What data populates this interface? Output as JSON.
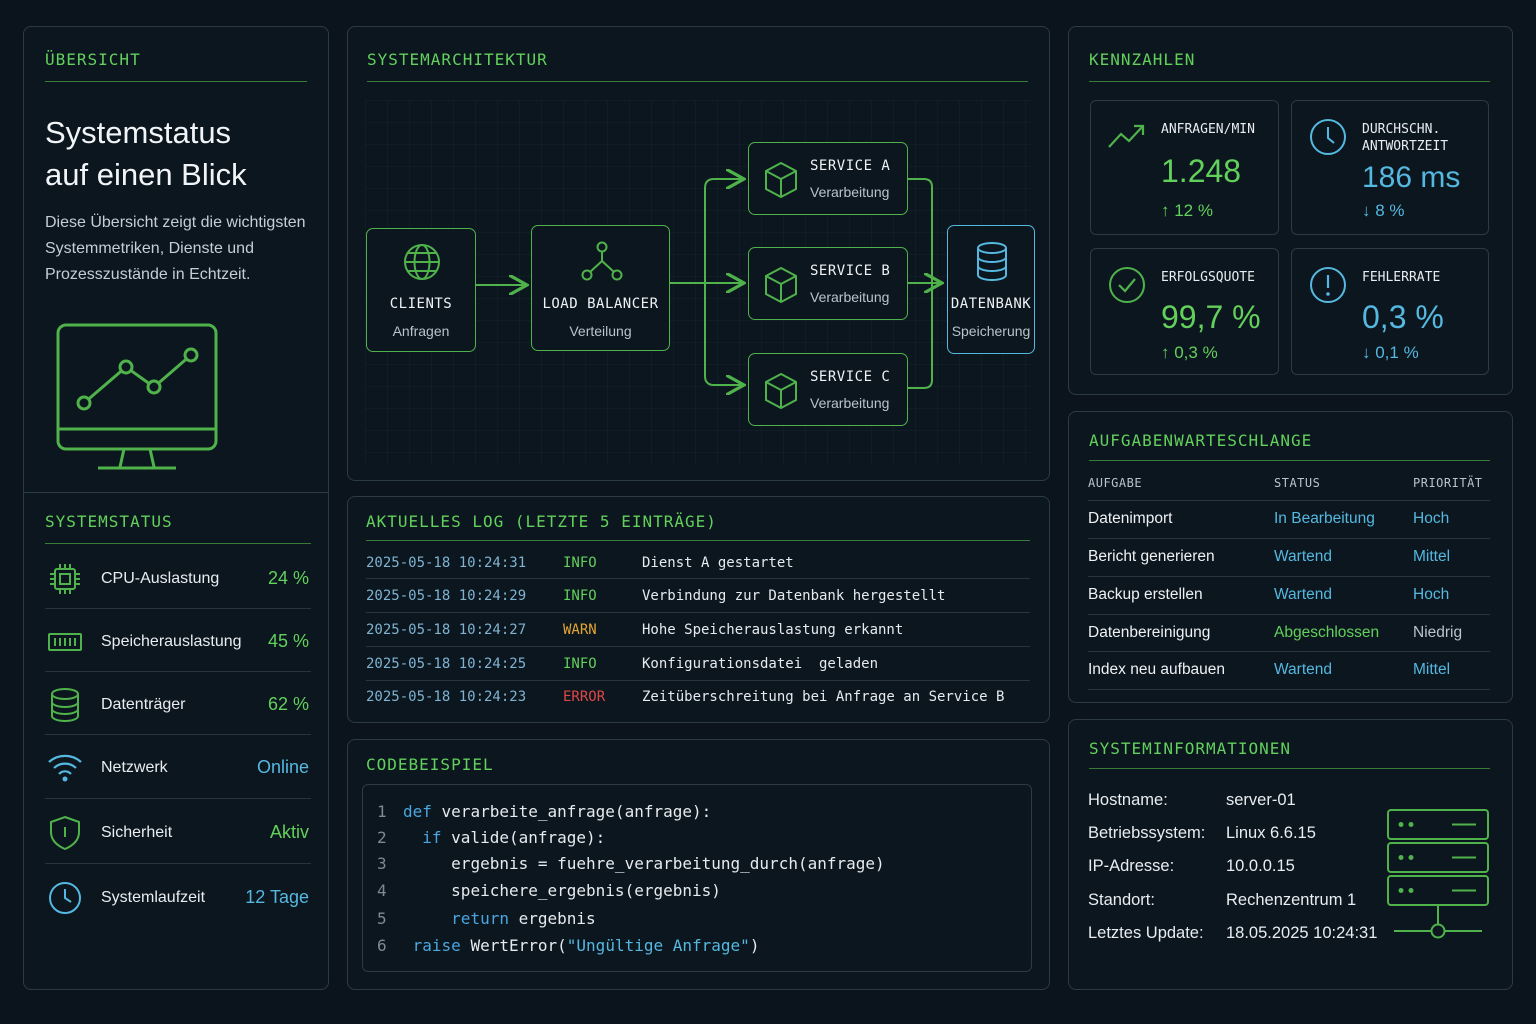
{
  "overview": {
    "title": "ÜBERSICHT",
    "headline_1": "Systemstatus",
    "headline_2": "auf einen Blick",
    "description": "Diese Übersicht zeigt die wichtigsten Systemmetriken, Dienste und Prozesszustände in Echtzeit.",
    "illustration_icon": "monitor-chart-icon"
  },
  "systemstatus": {
    "title": "SYSTEMSTATUS",
    "items": [
      {
        "label": "CPU-Auslastung",
        "value": "24 %",
        "icon": "cpu-icon",
        "color": "#62d15c"
      },
      {
        "label": "Speicherauslastung",
        "value": "45 %",
        "icon": "memory-icon",
        "color": "#62d15c"
      },
      {
        "label": "Datenträger",
        "value": "62 %",
        "icon": "database-icon",
        "color": "#62d15c"
      },
      {
        "label": "Netzwerk",
        "value": "Online",
        "icon": "wifi-icon",
        "color": "#55b8e0"
      },
      {
        "label": "Sicherheit",
        "value": "Aktiv",
        "icon": "shield-icon",
        "color": "#62d15c"
      },
      {
        "label": "Systemlaufzeit",
        "value": "12 Tage",
        "icon": "clock-icon",
        "color": "#55b8e0"
      }
    ]
  },
  "architecture": {
    "title": "SYSTEMARCHITEKTUR",
    "nodes": {
      "clients": {
        "title": "CLIENTS",
        "subtitle": "Anfragen",
        "icon": "globe-icon"
      },
      "load_balancer": {
        "title": "LOAD BALANCER",
        "subtitle": "Verteilung",
        "icon": "network-icon"
      },
      "service_a": {
        "title": "SERVICE A",
        "subtitle": "Verarbeitung",
        "icon": "cube-icon"
      },
      "service_b": {
        "title": "SERVICE B",
        "subtitle": "Verarbeitung",
        "icon": "cube-icon"
      },
      "service_c": {
        "title": "SERVICE C",
        "subtitle": "Verarbeitung",
        "icon": "cube-icon"
      },
      "database": {
        "title": "DATENBANK",
        "subtitle": "Speicherung",
        "icon": "database-icon"
      }
    }
  },
  "kpis": {
    "title": "KENNZAHLEN",
    "items": [
      {
        "label": "ANFRAGEN/MIN",
        "value": "1.248",
        "trend": "↑ 12 %",
        "icon": "trend-up-icon",
        "color": "#62d15c"
      },
      {
        "label": "DURCHSCHN. ANTWORTZEIT",
        "value": "186 ms",
        "trend": "↓ 8 %",
        "icon": "clock-icon",
        "color": "#55b8e0"
      },
      {
        "label": "ERFOLGSQUOTE",
        "value": "99,7 %",
        "trend": "↑ 0,3 %",
        "icon": "check-circle-icon",
        "color": "#62d15c"
      },
      {
        "label": "FEHLERRATE",
        "value": "0,3 %",
        "trend": "↓ 0,1 %",
        "icon": "alert-circle-icon",
        "color": "#55b8e0"
      }
    ]
  },
  "log": {
    "title": "AKTUELLES LOG (LETZTE 5 EINTRÄGE)",
    "entries": [
      {
        "timestamp": "2025-05-18 10:24:31",
        "level": "INFO",
        "message": "Dienst A gestartet",
        "color": "#62d15c"
      },
      {
        "timestamp": "2025-05-18 10:24:29",
        "level": "INFO",
        "message": "Verbindung zur Datenbank hergestellt",
        "color": "#62d15c"
      },
      {
        "timestamp": "2025-05-18 10:24:27",
        "level": "WARN",
        "message": "Hohe Speicherauslastung erkannt",
        "color": "#e3a532"
      },
      {
        "timestamp": "2025-05-18 10:24:25",
        "level": "INFO",
        "message": "Konfigurationsdatei  geladen",
        "color": "#62d15c"
      },
      {
        "timestamp": "2025-05-18 10:24:23",
        "level": "ERROR",
        "message": "Zeitüberschreitung bei Anfrage an Service B",
        "color": "#e04848"
      }
    ]
  },
  "code": {
    "title": "CODEBEISPIEL",
    "lines": [
      {
        "n": "1",
        "indent": "",
        "kw": "def",
        "rest": " verarbeite_anfrage(anfrage):",
        "str": "",
        "end": ""
      },
      {
        "n": "2",
        "indent": "  ",
        "kw": "if",
        "rest": " valide(anfrage):",
        "str": "",
        "end": ""
      },
      {
        "n": "3",
        "indent": "     ",
        "kw": "",
        "rest": "ergebnis = fuehre_verarbeitung_durch(anfrage)",
        "str": "",
        "end": ""
      },
      {
        "n": "4",
        "indent": "     ",
        "kw": "",
        "rest": "speichere_ergebnis(ergebnis)",
        "str": "",
        "end": ""
      },
      {
        "n": "5",
        "indent": "     ",
        "kw": "return",
        "rest": " ergebnis",
        "str": "",
        "end": ""
      },
      {
        "n": "6",
        "indent": " ",
        "kw": "raise",
        "rest": " WertError(",
        "str": "\"Ungültige Anfrage\"",
        "end": ")"
      }
    ]
  },
  "queue": {
    "title": "AUFGABENWARTESCHLANGE",
    "headers": [
      "AUFGABE",
      "STATUS",
      "PRIORITÄT"
    ],
    "rows": [
      {
        "task": "Datenimport",
        "status": "In Bearbeitung",
        "priority": "Hoch",
        "status_color": "#55b8e0",
        "priority_color": "#55b8e0"
      },
      {
        "task": "Bericht generieren",
        "status": "Wartend",
        "priority": "Mittel",
        "status_color": "#55b8e0",
        "priority_color": "#55b8e0"
      },
      {
        "task": "Backup erstellen",
        "status": "Wartend",
        "priority": "Hoch",
        "status_color": "#55b8e0",
        "priority_color": "#55b8e0"
      },
      {
        "task": "Datenbereinigung",
        "status": "Abgeschlossen",
        "priority": "Niedrig",
        "status_color": "#62d15c",
        "priority_color": "#b9c3cb"
      },
      {
        "task": "Index neu aufbauen",
        "status": "Wartend",
        "priority": "Mittel",
        "status_color": "#55b8e0",
        "priority_color": "#55b8e0"
      }
    ]
  },
  "sysinfo": {
    "title": "SYSTEMINFORMATIONEN",
    "rows": [
      {
        "key": "Hostname:",
        "value": "server-01"
      },
      {
        "key": "Betriebssystem:",
        "value": "Linux 6.6.15"
      },
      {
        "key": "IP-Adresse:",
        "value": "10.0.0.15"
      },
      {
        "key": "Standort:",
        "value": "Rechenzentrum 1"
      },
      {
        "key": "Letztes Update:",
        "value": "18.05.2025 10:24:31"
      }
    ],
    "illustration_icon": "server-rack-icon"
  }
}
